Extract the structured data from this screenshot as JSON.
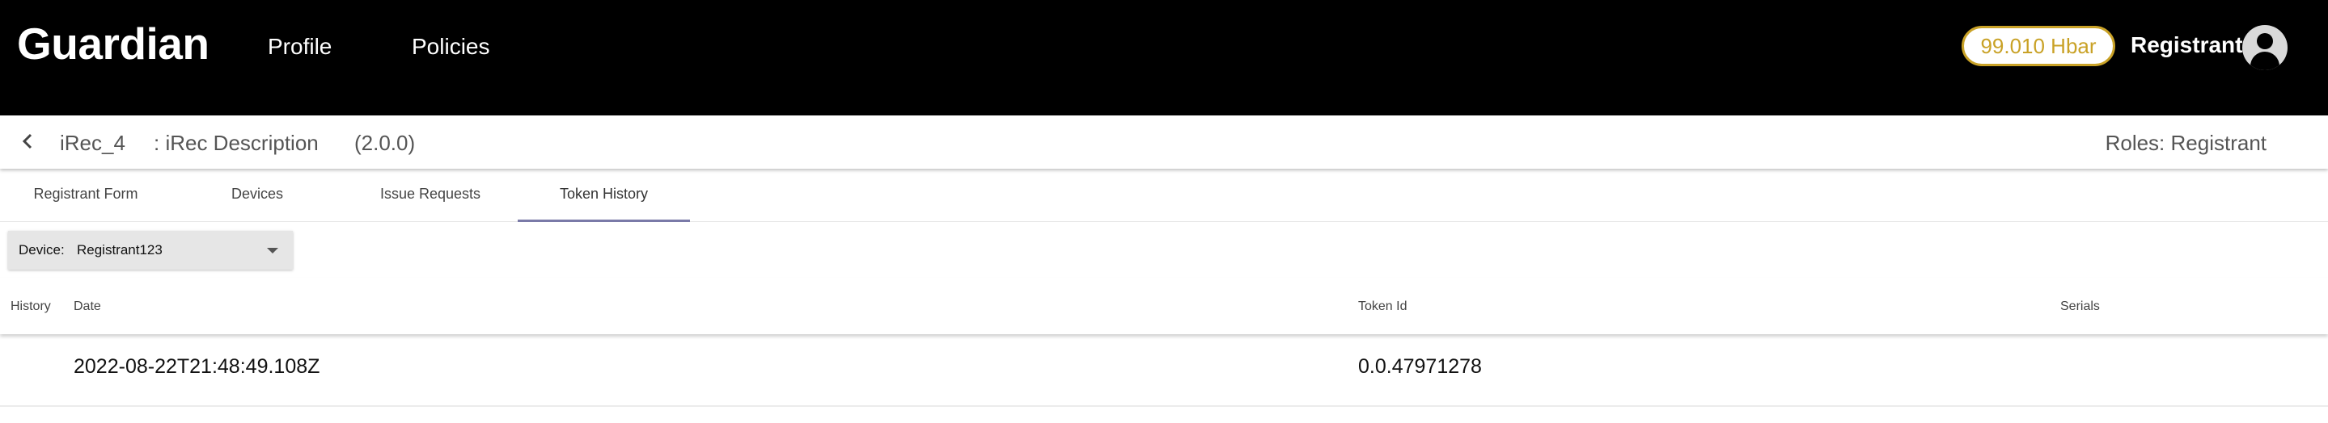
{
  "header": {
    "logo": "Guardian",
    "nav": {
      "profile": "Profile",
      "policies": "Policies"
    },
    "balance": "99.010 Hbar",
    "user": "Registrant",
    "avatar_icon": "account-circle-icon",
    "accent_color": "#c9a227"
  },
  "policy": {
    "name": "iRec_4",
    "description": ": iRec Description",
    "version": "(2.0.0)",
    "roles": "Roles: Registrant",
    "back_icon": "chevron-left-icon"
  },
  "tabs": [
    {
      "label": "Registrant Form",
      "active": false
    },
    {
      "label": "Devices",
      "active": false
    },
    {
      "label": "Issue Requests",
      "active": false
    },
    {
      "label": "Token History",
      "active": true
    }
  ],
  "device_filter": {
    "label": "Device:",
    "value": "Registrant123",
    "caret_icon": "arrow-drop-down-icon"
  },
  "table": {
    "columns": [
      "History",
      "Date",
      "Token Id",
      "Serials"
    ],
    "rows": [
      {
        "history": "",
        "date": "2022-08-22T21:48:49.108Z",
        "token_id": "0.0.47971278",
        "serials": ""
      }
    ]
  }
}
